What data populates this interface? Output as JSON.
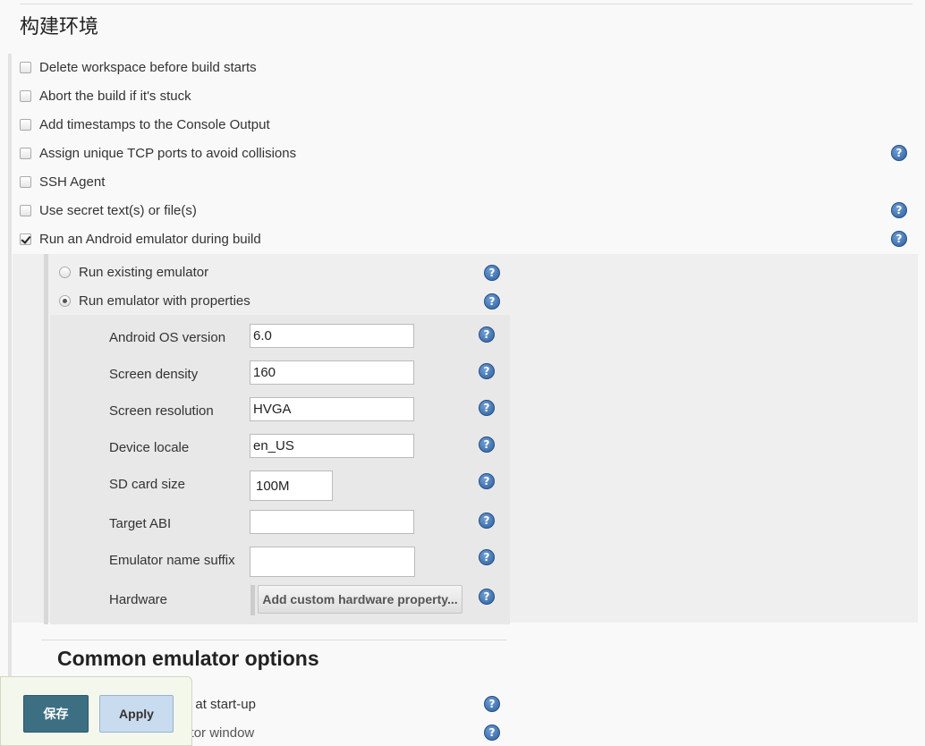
{
  "section": {
    "title": "构建环境"
  },
  "options": [
    {
      "label": "Delete workspace before build starts",
      "checked": false
    },
    {
      "label": "Abort the build if it's stuck",
      "checked": false
    },
    {
      "label": "Add timestamps to the Console Output",
      "checked": false
    },
    {
      "label": "Assign unique TCP ports to avoid collisions",
      "checked": false
    },
    {
      "label": "SSH Agent",
      "checked": false
    },
    {
      "label": "Use secret text(s) or file(s)",
      "checked": false
    },
    {
      "label": "Run an Android emulator during build",
      "checked": true
    }
  ],
  "emulator": {
    "modes": [
      {
        "label": "Run existing emulator",
        "selected": false
      },
      {
        "label": "Run emulator with properties",
        "selected": true
      }
    ],
    "fields": [
      {
        "label": "Android OS version",
        "value": "6.0"
      },
      {
        "label": "Screen density",
        "value": "160"
      },
      {
        "label": "Screen resolution",
        "value": "HVGA"
      },
      {
        "label": "Device locale",
        "value": "en_US"
      },
      {
        "label": "SD card size",
        "value": "100M"
      },
      {
        "label": "Target ABI",
        "value": ""
      },
      {
        "label": "Emulator name suffix",
        "value": ""
      }
    ],
    "hardware": {
      "label": "Hardware",
      "button": "Add custom hardware property..."
    }
  },
  "common": {
    "title": "Common emulator options",
    "items": [
      {
        "label": "ulator state at start-up"
      },
      {
        "label": "Show emulator window"
      }
    ]
  },
  "help_icon": "?",
  "footer": {
    "save_label": "保存",
    "apply_label": "Apply"
  }
}
